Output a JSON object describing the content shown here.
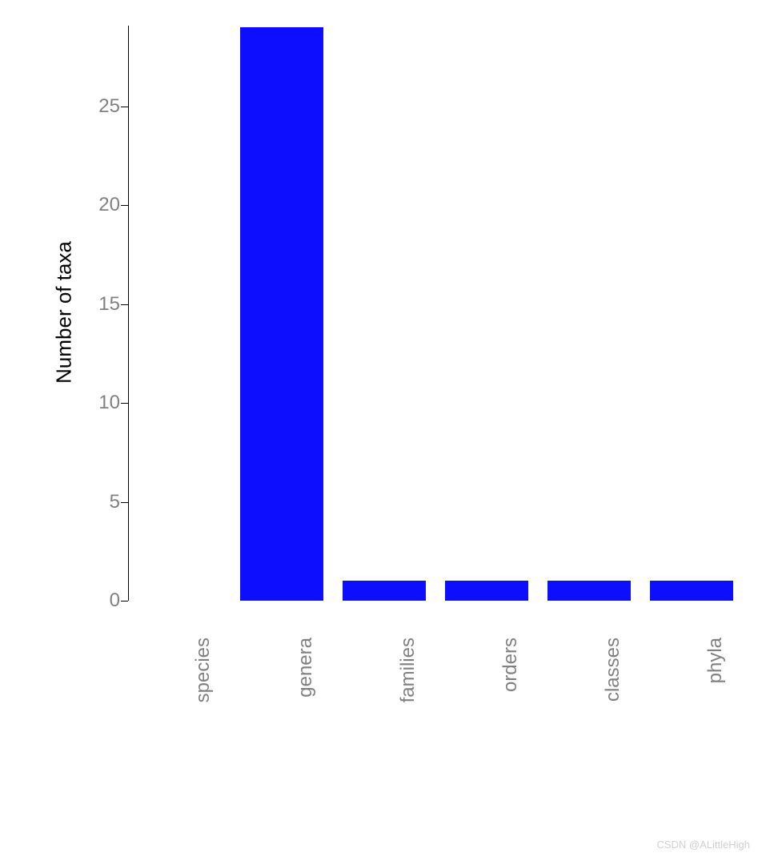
{
  "chart_data": {
    "type": "bar",
    "categories": [
      "species",
      "genera",
      "families",
      "orders",
      "classes",
      "phyla"
    ],
    "values": [
      0,
      29,
      1,
      1,
      1,
      1
    ],
    "title": "",
    "xlabel": "",
    "ylabel": "Number of taxa",
    "ylim": [
      0,
      25
    ],
    "y_ticks": [
      0,
      5,
      10,
      15,
      20,
      25
    ],
    "bar_color": "#0e0eff"
  },
  "watermark": "CSDN @ALittleHigh"
}
